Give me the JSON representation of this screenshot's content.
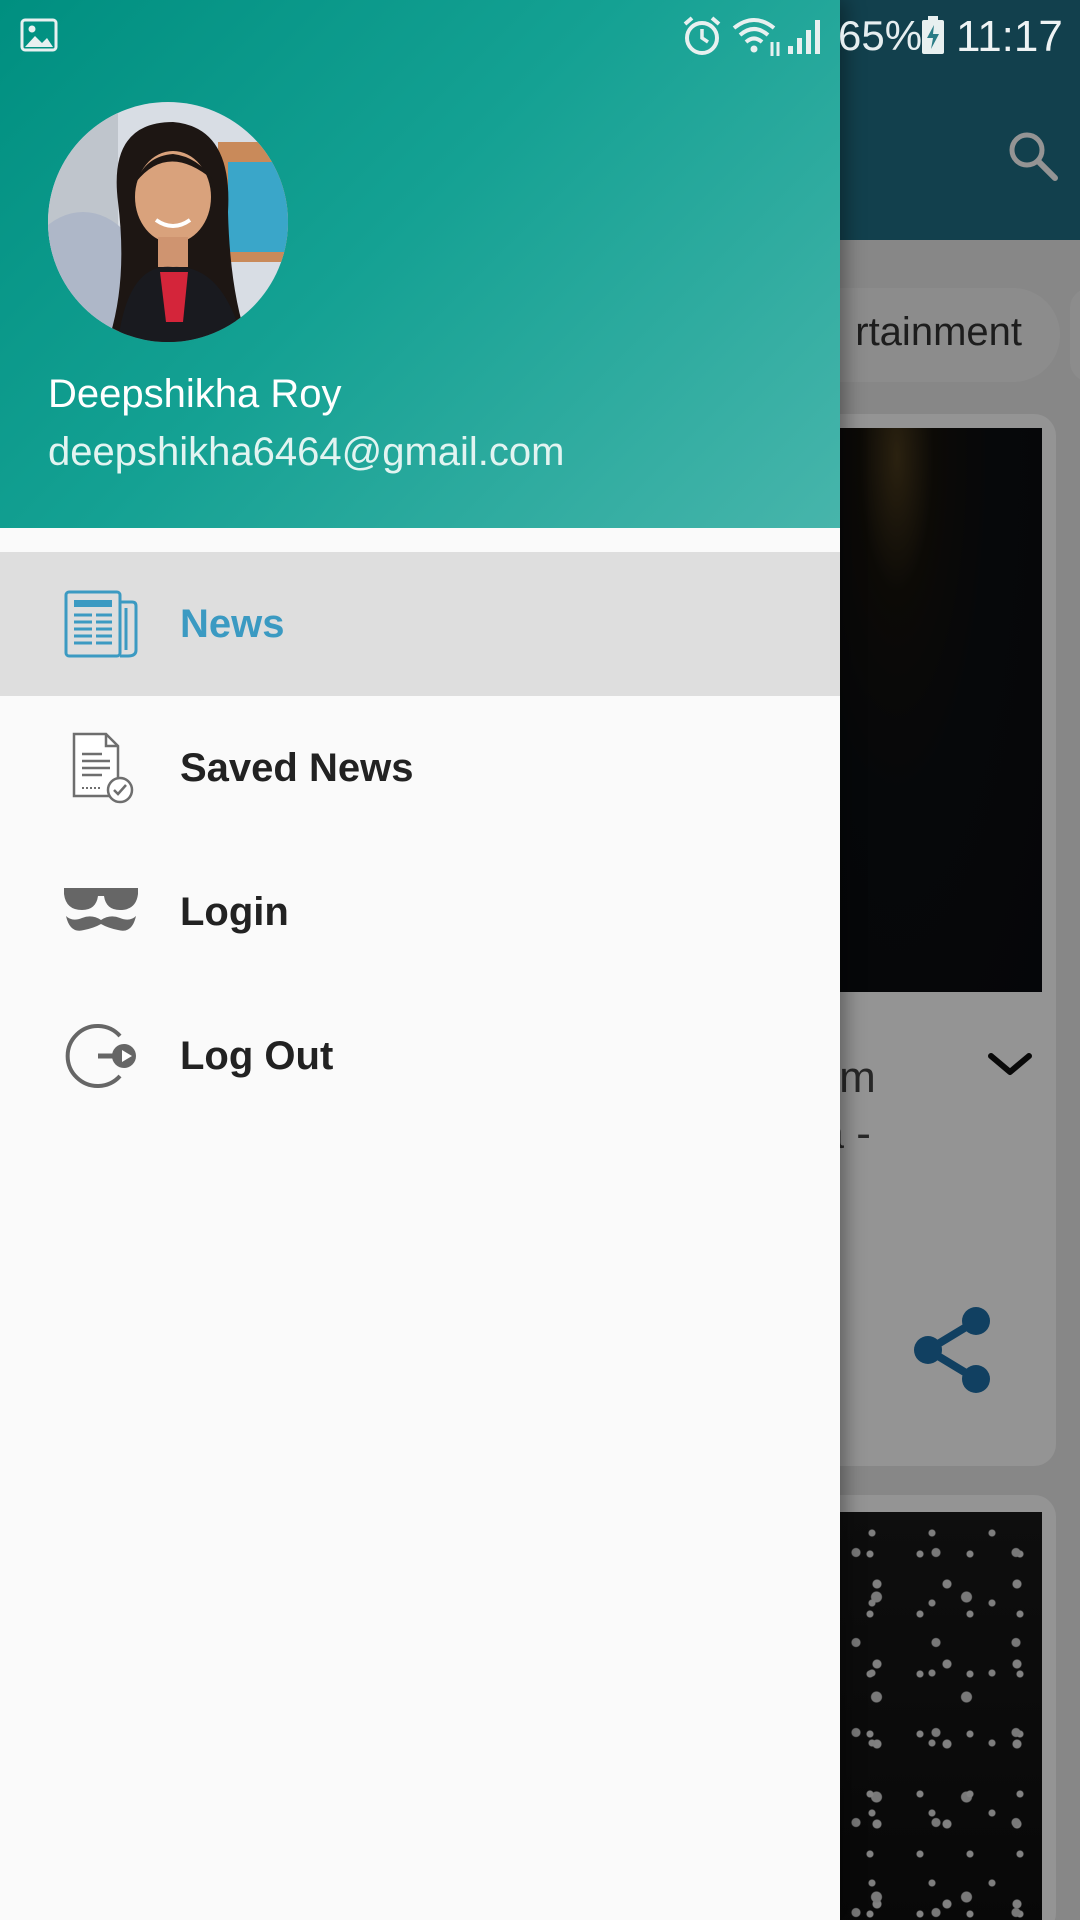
{
  "status_bar": {
    "battery_percent": "65%",
    "time": "11:17",
    "icons": [
      "gallery-icon",
      "alarm-icon",
      "wifi-icon",
      "signal-icon",
      "battery-charging-icon"
    ]
  },
  "background": {
    "category_chip_partial": "rtainment",
    "card_text_partial": "rom\nlia -",
    "icons": [
      "search-icon",
      "chevron-down-icon",
      "share-icon"
    ]
  },
  "drawer": {
    "user": {
      "name": "Deepshikha Roy",
      "email": "deepshikha6464@gmail.com"
    },
    "items": [
      {
        "label": "News",
        "icon": "newspaper-icon",
        "active": true
      },
      {
        "label": "Saved News",
        "icon": "saved-document-icon",
        "active": false
      },
      {
        "label": "Login",
        "icon": "glasses-mustache-icon",
        "active": false
      },
      {
        "label": "Log Out",
        "icon": "logout-icon",
        "active": false
      }
    ]
  },
  "colors": {
    "header_gradient_start": "#008f80",
    "header_gradient_end": "#47b5ab",
    "active_item_bg": "#dedede",
    "active_item_text": "#3b9ac2",
    "toolbar": "#1f6f86"
  }
}
